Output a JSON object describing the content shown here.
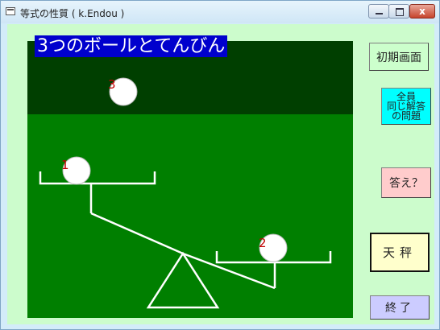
{
  "window": {
    "title": "等式の性質 ( k.Endou )",
    "close_glyph": "x"
  },
  "heading": "3つのボールとてんびん",
  "stage": {
    "balls": [
      {
        "label": "3"
      },
      {
        "label": "1"
      },
      {
        "label": "2"
      }
    ]
  },
  "buttons": {
    "initial_screen": "初期画面",
    "same_answer_line1": "全員",
    "same_answer_line2": "同じ解答",
    "same_answer_line3": "の問題",
    "answer": "答え？",
    "balance": "天秤",
    "end": "終了"
  },
  "colors": {
    "client_background": "#ccfccc",
    "stage_green": "#007f00",
    "stage_dark_green": "#003f00",
    "heading_blue": "#0000cd",
    "ball_label_red": "#c00000"
  }
}
